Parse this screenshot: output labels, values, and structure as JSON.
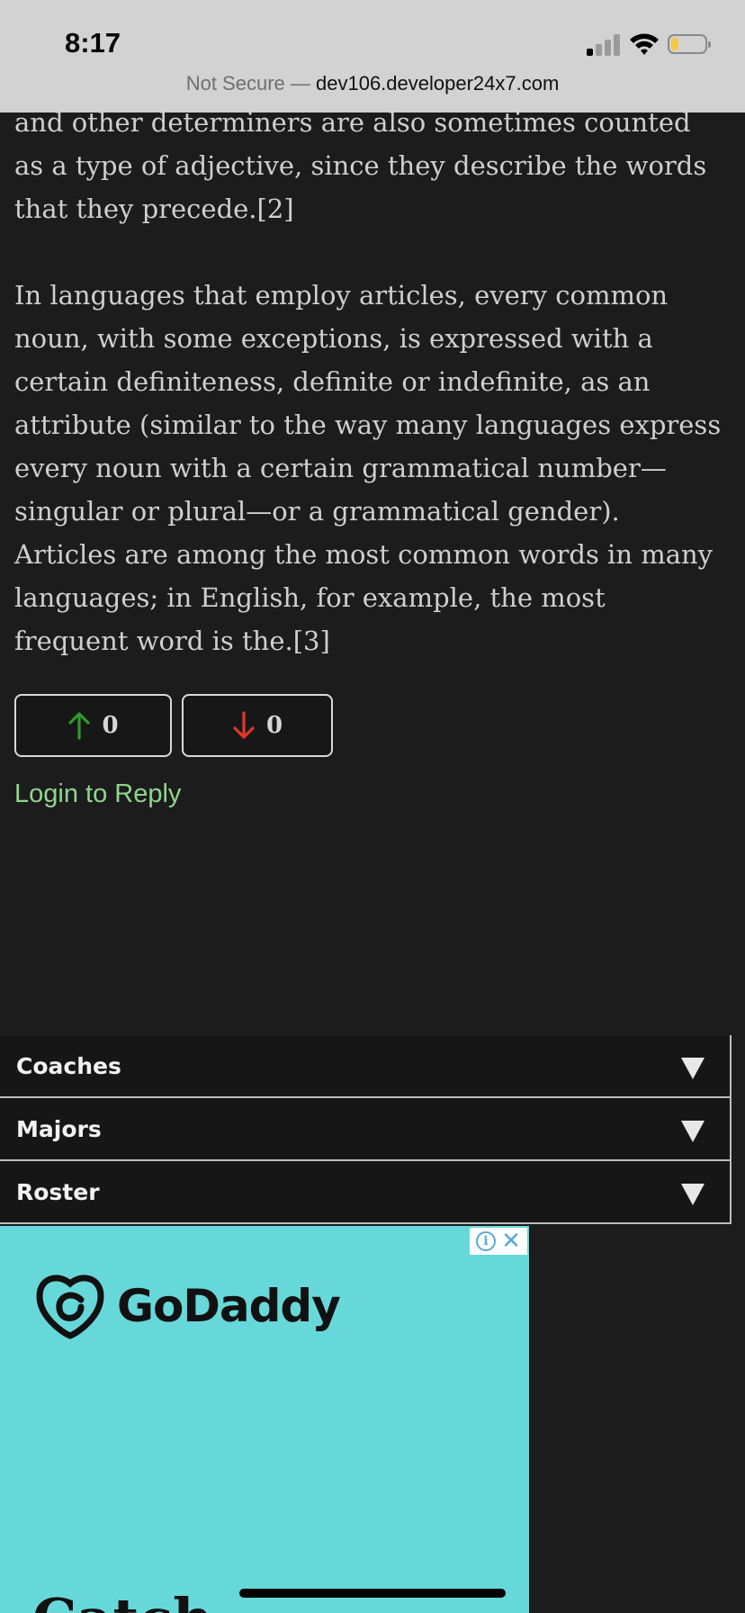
{
  "status_bar": {
    "time": "8:17",
    "signal_bars": 4,
    "signal_active": 1,
    "battery_color": "#f2c744"
  },
  "url_bar": {
    "not_secure": "Not Secure",
    "separator": " — ",
    "domain": "dev106.developer24x7.com"
  },
  "article": {
    "paragraph1": "and other determiners are also sometimes counted as a type of adjective, since they describe the words that they precede.[2]",
    "paragraph2": "In languages that employ articles, every common noun, with some exceptions, is expressed with a certain definiteness, definite or indefinite, as an attribute (similar to the way many languages express every noun with a certain grammatical number—singular or plural—or a grammatical gender). Articles are among the most common words in many languages; in English, for example, the most frequent word is the.[3]"
  },
  "votes": {
    "up_count": "0",
    "down_count": "0",
    "up_icon": "arrow-up-icon",
    "down_icon": "arrow-down-icon",
    "up_color": "#2e9a2e",
    "down_color": "#e0372a"
  },
  "reply_link": "Login to Reply",
  "accordion": [
    {
      "label": "Coaches"
    },
    {
      "label": "Majors"
    },
    {
      "label": "Roster"
    }
  ],
  "ad": {
    "brand": "GoDaddy",
    "background": "#67d8da",
    "partial_text": "Catch"
  }
}
